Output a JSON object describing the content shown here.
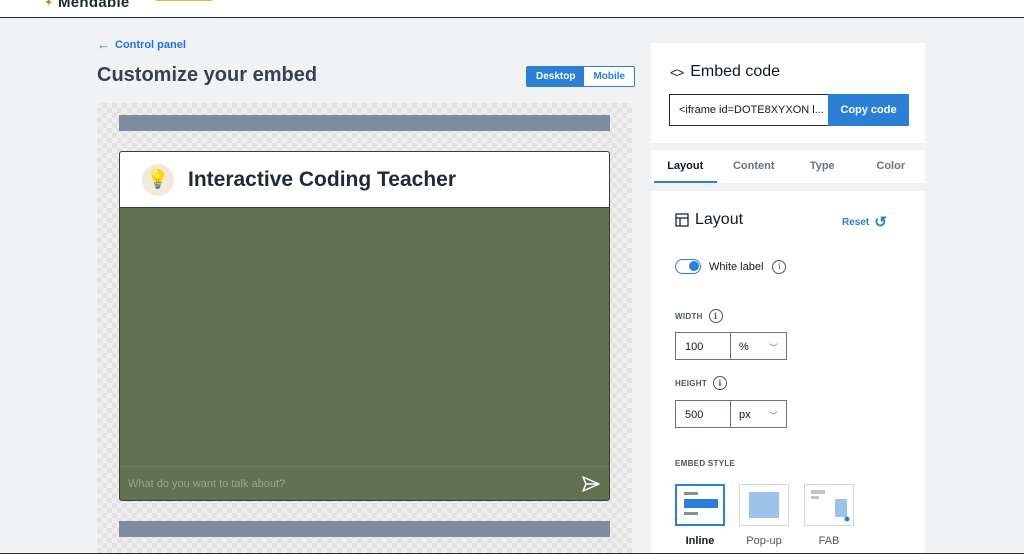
{
  "topbar": {
    "brand": "Mendable"
  },
  "back_link": {
    "label": "Control panel"
  },
  "page_title": "Customize your embed",
  "device_toggle": {
    "desktop": "Desktop",
    "mobile": "Mobile",
    "selected": "Desktop"
  },
  "chat_widget": {
    "title": "Interactive Coding Teacher",
    "input_placeholder": "What do you want to talk about?",
    "bg_color": "#617152"
  },
  "embed_code": {
    "title": "Embed code",
    "value": "<iframe id=DOTE8XYXON l...",
    "copy_label": "Copy code"
  },
  "tabs": [
    {
      "label": "Layout",
      "active": true
    },
    {
      "label": "Content",
      "active": false
    },
    {
      "label": "Type",
      "active": false
    },
    {
      "label": "Color",
      "active": false
    }
  ],
  "layout": {
    "title": "Layout",
    "reset_label": "Reset",
    "white_label": {
      "label": "White label",
      "enabled": true
    },
    "width": {
      "label": "WIDTH",
      "value": "100",
      "unit": "%"
    },
    "height": {
      "label": "HEIGHT",
      "value": "500",
      "unit": "px"
    },
    "embed_style": {
      "label": "EMBED STYLE",
      "options": [
        "Inline",
        "Pop-up",
        "FAB"
      ],
      "selected": "Inline"
    }
  },
  "colors": {
    "accent": "#2b7fd4"
  }
}
